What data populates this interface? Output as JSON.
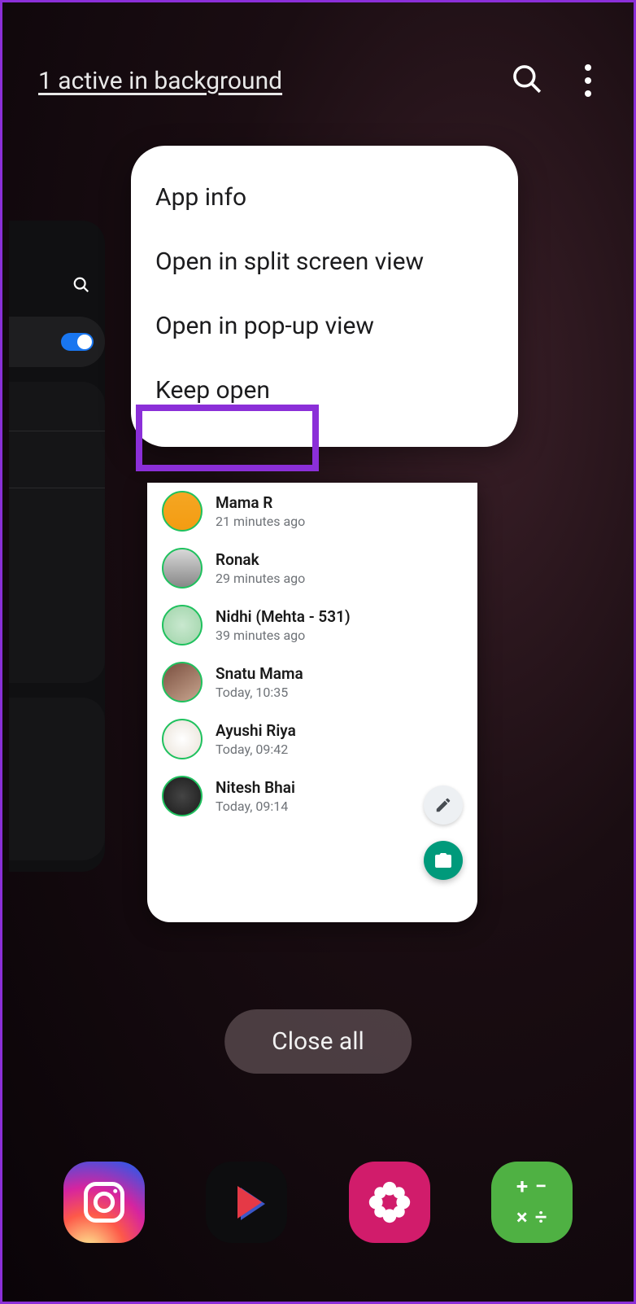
{
  "header": {
    "background_link": "1 active in background"
  },
  "context_menu": {
    "items": [
      "App info",
      "Open in split screen view",
      "Open in pop-up view",
      "Keep open"
    ]
  },
  "app_card": {
    "statuses": [
      {
        "name": "Mama R",
        "time": "21 minutes ago"
      },
      {
        "name": "Ronak",
        "time": "29 minutes ago"
      },
      {
        "name": "Nidhi (Mehta - 531)",
        "time": "39 minutes ago"
      },
      {
        "name": "Snatu Mama",
        "time": "Today, 10:35"
      },
      {
        "name": "Ayushi Riya",
        "time": "Today, 09:42"
      },
      {
        "name": "Nitesh Bhai",
        "time": "Today, 09:14"
      }
    ]
  },
  "close_all_label": "Close all",
  "dock": {
    "apps": [
      "Instagram",
      "YouTube",
      "Gallery",
      "Calculator"
    ]
  }
}
